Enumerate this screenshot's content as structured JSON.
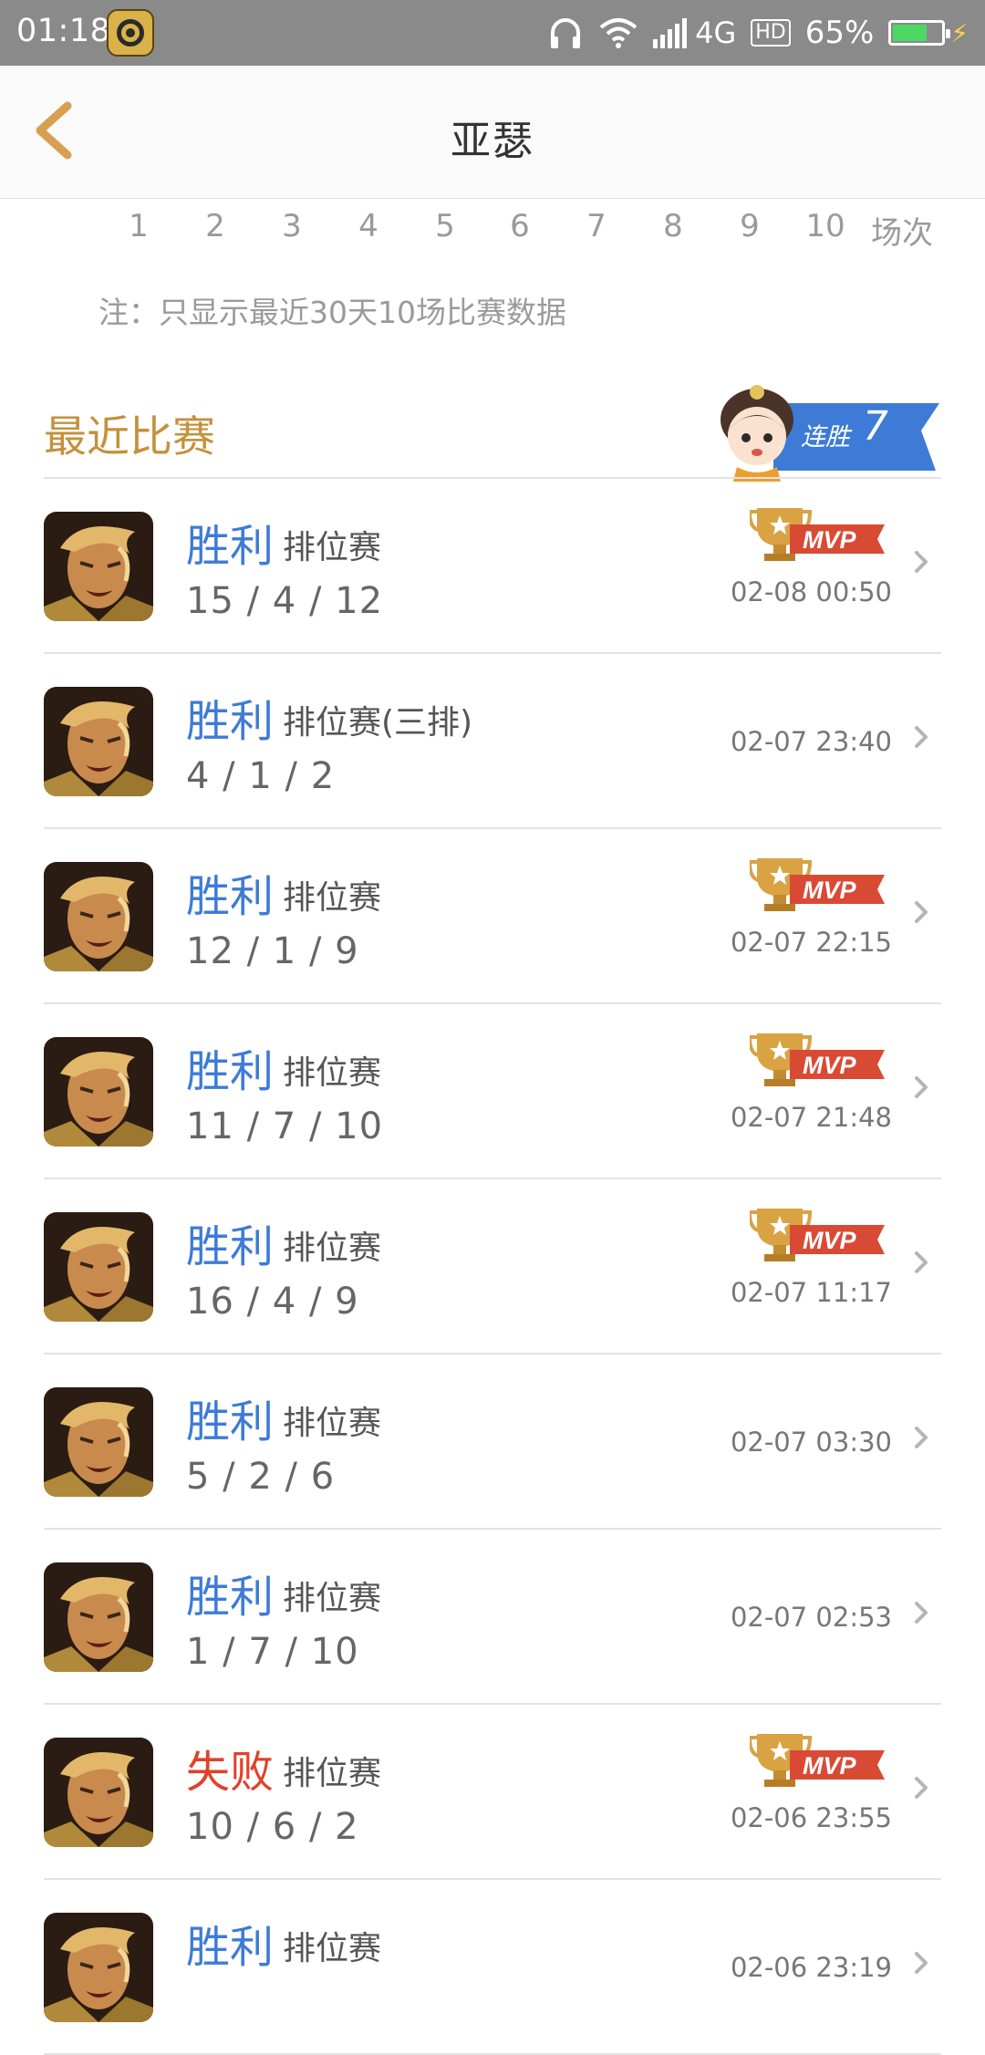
{
  "status_bar": {
    "time": "01:18",
    "network": "4G",
    "hd": "HD",
    "battery_percent_label": "65%",
    "battery_level": 0.65,
    "colors": {
      "background": "#8a8a8a",
      "battery": "#4cd964"
    }
  },
  "header": {
    "title": "亚瑟",
    "back_icon": "chevron-left-icon",
    "accent_color": "#d7a050"
  },
  "chart_axis": {
    "ticks": [
      "1",
      "2",
      "3",
      "4",
      "5",
      "6",
      "7",
      "8",
      "9",
      "10"
    ],
    "unit": "场次"
  },
  "note": "注：只显示最近30天10场比赛数据",
  "recent": {
    "title": "最近比赛",
    "streak_label": "连胜",
    "streak_value": "7",
    "colors": {
      "title": "#c4913b",
      "ribbon": "#3d7bd6"
    }
  },
  "result_colors": {
    "win": "#3d7bd6",
    "loss": "#e0412a"
  },
  "matches": [
    {
      "result": "胜利",
      "outcome": "win",
      "mode": "排位赛",
      "kda": "15 / 4 / 12",
      "time": "02-08 00:50",
      "mvp": true
    },
    {
      "result": "胜利",
      "outcome": "win",
      "mode": "排位赛(三排)",
      "kda": "4 / 1 / 2",
      "time": "02-07 23:40",
      "mvp": false
    },
    {
      "result": "胜利",
      "outcome": "win",
      "mode": "排位赛",
      "kda": "12 / 1 / 9",
      "time": "02-07 22:15",
      "mvp": true
    },
    {
      "result": "胜利",
      "outcome": "win",
      "mode": "排位赛",
      "kda": "11 / 7 / 10",
      "time": "02-07 21:48",
      "mvp": true
    },
    {
      "result": "胜利",
      "outcome": "win",
      "mode": "排位赛",
      "kda": "16 / 4 / 9",
      "time": "02-07 11:17",
      "mvp": true
    },
    {
      "result": "胜利",
      "outcome": "win",
      "mode": "排位赛",
      "kda": "5 / 2 / 6",
      "time": "02-07 03:30",
      "mvp": false
    },
    {
      "result": "胜利",
      "outcome": "win",
      "mode": "排位赛",
      "kda": "1 / 7 / 10",
      "time": "02-07 02:53",
      "mvp": false
    },
    {
      "result": "失败",
      "outcome": "loss",
      "mode": "排位赛",
      "kda": "10 / 6 / 2",
      "time": "02-06 23:55",
      "mvp": true
    },
    {
      "result": "胜利",
      "outcome": "win",
      "mode": "排位赛",
      "kda": "",
      "time": "02-06 23:19",
      "mvp": false
    }
  ],
  "mvp_badge": {
    "text": "MVP",
    "icon": "trophy-icon",
    "colors": {
      "trophy": "#d9a243",
      "banner": "#d94a35"
    }
  },
  "row_chevron_icon": "chevron-right-icon"
}
